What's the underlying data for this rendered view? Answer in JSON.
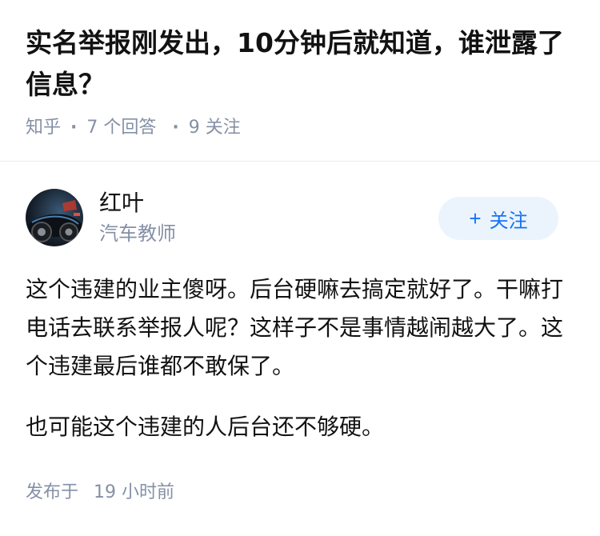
{
  "question": {
    "title": "实名举报刚发出，10分钟后就知道，谁泄露了信息？",
    "source": "知乎",
    "answer_count": "7 个回答",
    "follower_count": "9 关注"
  },
  "author": {
    "name": "红叶",
    "headline": "汽车教师",
    "follow_label": "关注",
    "follow_icon": "plus-icon"
  },
  "answer": {
    "paragraphs": [
      "这个违建的业主傻呀。后台硬嘛去搞定就好了。干嘛打电话去联系举报人呢？这样子不是事情越闹越大了。这个违建最后谁都不敢保了。",
      "也可能这个违建的人后台还不够硬。"
    ],
    "published_label": "发布于",
    "published_time": "19 小时前"
  },
  "colors": {
    "text_primary": "#121212",
    "text_secondary": "#8590a6",
    "accent": "#1772f6",
    "follow_bg": "#ebf4fd",
    "divider": "#ebebeb"
  }
}
